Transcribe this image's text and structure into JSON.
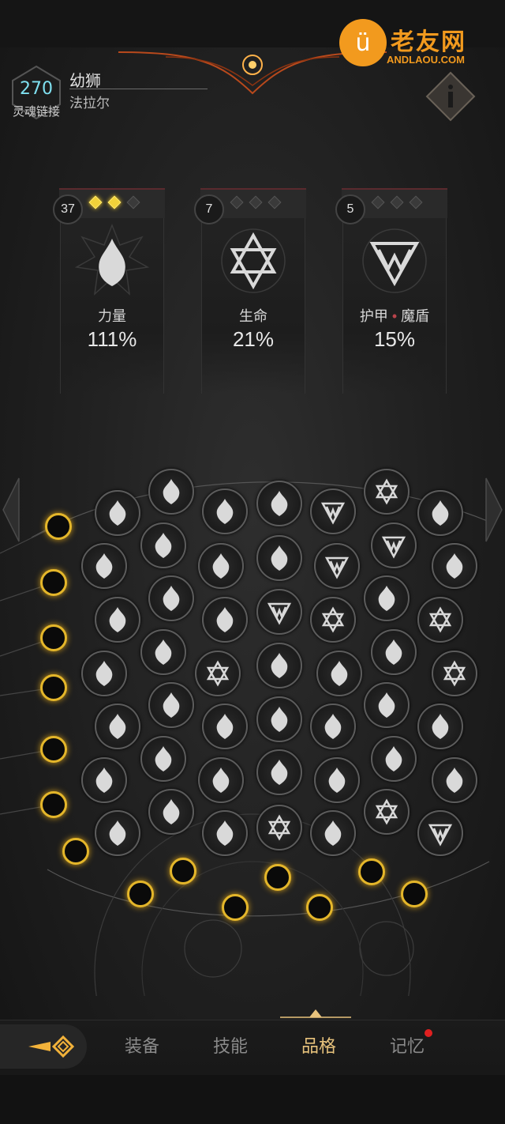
{
  "header": {
    "level": "270",
    "level_label": "灵魂链接",
    "name": "幼狮",
    "class": "法拉尔"
  },
  "watermark": {
    "brand": "老友网",
    "url": "ANDLAOU.COM"
  },
  "stats": [
    {
      "count": "37",
      "label": "力量",
      "value": "111%",
      "pips_on": 2,
      "pips_total": 3,
      "emblem": "flame-icon"
    },
    {
      "count": "7",
      "label": "生命",
      "value": "21%",
      "pips_on": 0,
      "pips_total": 3,
      "emblem": "hexagram-icon"
    },
    {
      "count": "5",
      "label_a": "护甲",
      "label_b": "魔盾",
      "value": "15%",
      "pips_on": 0,
      "pips_total": 3,
      "emblem": "triangle-rune-icon"
    }
  ],
  "grid_legend": {
    "flame": "flame-icon",
    "star": "hexagram-icon",
    "tri": "triangle-rune-icon"
  },
  "nav": {
    "items": [
      "装备",
      "技能",
      "品格",
      "记忆"
    ],
    "active": "品格",
    "badge_on": "记忆"
  },
  "colors": {
    "accent_gold": "#e4b62a",
    "level_cyan": "#7fe0f0",
    "active_tab": "#e7c27c",
    "badge_red": "#e02020"
  }
}
